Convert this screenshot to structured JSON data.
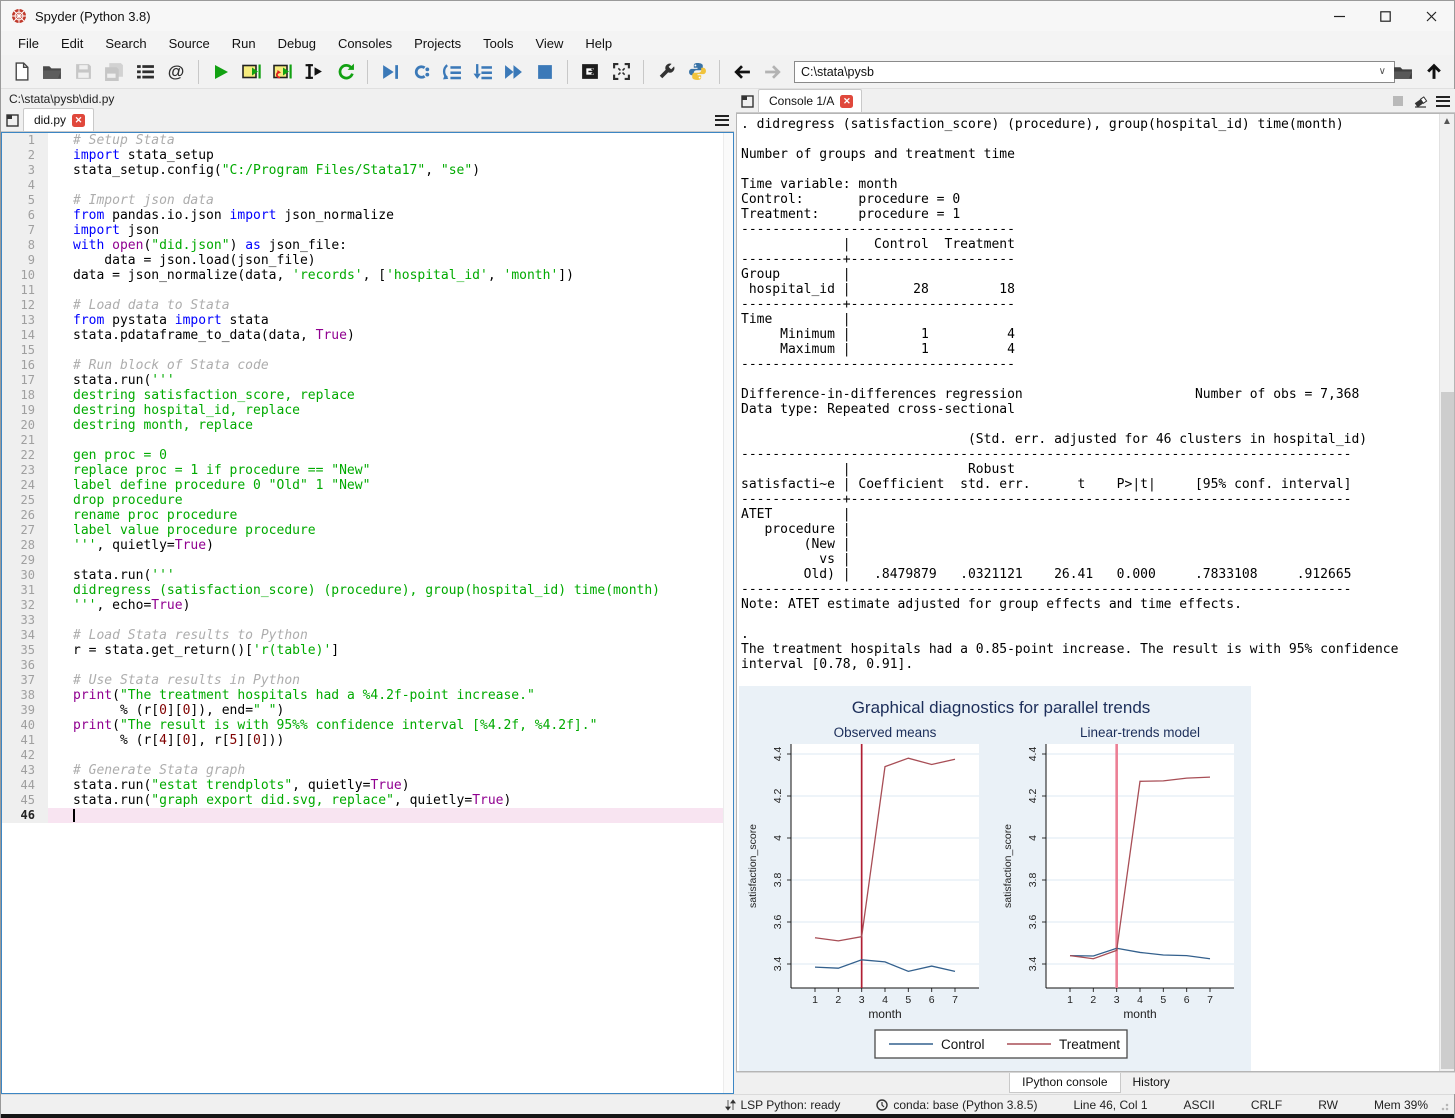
{
  "window": {
    "title": "Spyder (Python 3.8)"
  },
  "menu": [
    "File",
    "Edit",
    "Search",
    "Source",
    "Run",
    "Debug",
    "Consoles",
    "Projects",
    "Tools",
    "View",
    "Help"
  ],
  "toolbar": {
    "groups": [
      [
        "new-file",
        "open-file",
        "save-file",
        "save-all",
        "file-switcher",
        "symbol-finder"
      ],
      [
        "run-file",
        "run-cell",
        "run-cell-advance",
        "run-selection",
        "rerun-cell"
      ],
      [
        "debug-file",
        "debug-continue",
        "debug-step-over",
        "debug-step-into",
        "debug-step-return",
        "debug-stop"
      ],
      [
        "maximize-pane",
        "fullscreen"
      ],
      [
        "preferences",
        "python-interpreter"
      ],
      [
        "back",
        "forward"
      ]
    ],
    "address": {
      "value": "C:\\stata\\pysb"
    },
    "right_icons": [
      "open-directory",
      "parent-directory"
    ]
  },
  "editor": {
    "breadcrumb": "C:\\stata\\pysb\\did.py",
    "tab": "did.py",
    "current_line": 46,
    "lines": [
      [
        [
          "c",
          "# Setup Stata"
        ]
      ],
      [
        [
          "k",
          "import"
        ],
        [
          "t",
          " stata_setup"
        ]
      ],
      [
        [
          "t",
          "stata_setup.config("
        ],
        [
          "s",
          "\"C:/Program Files/Stata17\""
        ],
        [
          "t",
          ", "
        ],
        [
          "s",
          "\"se\""
        ],
        [
          "t",
          ")"
        ]
      ],
      [],
      [
        [
          "c",
          "# Import json data"
        ]
      ],
      [
        [
          "k",
          "from"
        ],
        [
          "t",
          " pandas.io.json "
        ],
        [
          "k",
          "import"
        ],
        [
          "t",
          " json_normalize"
        ]
      ],
      [
        [
          "k",
          "import"
        ],
        [
          "t",
          " json"
        ]
      ],
      [
        [
          "k",
          "with"
        ],
        [
          "t",
          " "
        ],
        [
          "b",
          "open"
        ],
        [
          "t",
          "("
        ],
        [
          "s",
          "\"did.json\""
        ],
        [
          "t",
          ") "
        ],
        [
          "k",
          "as"
        ],
        [
          "t",
          " json_file:"
        ]
      ],
      [
        [
          "t",
          "    data = json.load(json_file)"
        ]
      ],
      [
        [
          "t",
          "data = json_normalize(data, "
        ],
        [
          "s",
          "'records'"
        ],
        [
          "t",
          ", ["
        ],
        [
          "s",
          "'hospital_id'"
        ],
        [
          "t",
          ", "
        ],
        [
          "s",
          "'month'"
        ],
        [
          "t",
          "])"
        ]
      ],
      [],
      [
        [
          "c",
          "# Load data to Stata"
        ]
      ],
      [
        [
          "k",
          "from"
        ],
        [
          "t",
          " pystata "
        ],
        [
          "k",
          "import"
        ],
        [
          "t",
          " stata"
        ]
      ],
      [
        [
          "t",
          "stata.pdataframe_to_data(data, "
        ],
        [
          "b",
          "True"
        ],
        [
          "t",
          ")"
        ]
      ],
      [],
      [
        [
          "c",
          "# Run block of Stata code"
        ]
      ],
      [
        [
          "t",
          "stata.run("
        ],
        [
          "s",
          "'''"
        ]
      ],
      [
        [
          "s",
          "destring satisfaction_score, replace"
        ]
      ],
      [
        [
          "s",
          "destring hospital_id, replace"
        ]
      ],
      [
        [
          "s",
          "destring month, replace"
        ]
      ],
      [],
      [
        [
          "s",
          "gen proc = 0"
        ]
      ],
      [
        [
          "s",
          "replace proc = 1 if procedure == \"New\""
        ]
      ],
      [
        [
          "s",
          "label define procedure 0 \"Old\" 1 \"New\""
        ]
      ],
      [
        [
          "s",
          "drop procedure"
        ]
      ],
      [
        [
          "s",
          "rename proc procedure"
        ]
      ],
      [
        [
          "s",
          "label value procedure procedure"
        ]
      ],
      [
        [
          "s",
          "'''"
        ],
        [
          "t",
          ", quietly="
        ],
        [
          "b",
          "True"
        ],
        [
          "t",
          ")"
        ]
      ],
      [],
      [
        [
          "t",
          "stata.run("
        ],
        [
          "s",
          "'''"
        ]
      ],
      [
        [
          "s",
          "didregress (satisfaction_score) (procedure), group(hospital_id) time(month)"
        ]
      ],
      [
        [
          "s",
          "'''"
        ],
        [
          "t",
          ", echo="
        ],
        [
          "b",
          "True"
        ],
        [
          "t",
          ")"
        ]
      ],
      [],
      [
        [
          "c",
          "# Load Stata results to Python"
        ]
      ],
      [
        [
          "t",
          "r = stata.get_return()["
        ],
        [
          "s",
          "'r(table)'"
        ],
        [
          "t",
          "]"
        ]
      ],
      [],
      [
        [
          "c",
          "# Use Stata results in Python"
        ]
      ],
      [
        [
          "b",
          "print"
        ],
        [
          "t",
          "("
        ],
        [
          "s",
          "\"The treatment hospitals had a %4.2f-point increase.\""
        ]
      ],
      [
        [
          "t",
          "      % (r["
        ],
        [
          "n",
          "0"
        ],
        [
          "t",
          "]["
        ],
        [
          "n",
          "0"
        ],
        [
          "t",
          "]), end="
        ],
        [
          "s",
          "\" \""
        ],
        [
          "t",
          ")"
        ]
      ],
      [
        [
          "b",
          "print"
        ],
        [
          "t",
          "("
        ],
        [
          "s",
          "\"The result is with 95%% confidence interval [%4.2f, %4.2f].\""
        ]
      ],
      [
        [
          "t",
          "      % (r["
        ],
        [
          "n",
          "4"
        ],
        [
          "t",
          "]["
        ],
        [
          "n",
          "0"
        ],
        [
          "t",
          "], r["
        ],
        [
          "n",
          "5"
        ],
        [
          "t",
          "]["
        ],
        [
          "n",
          "0"
        ],
        [
          "t",
          "]))"
        ]
      ],
      [],
      [
        [
          "c",
          "# Generate Stata graph"
        ]
      ],
      [
        [
          "t",
          "stata.run("
        ],
        [
          "s",
          "\"estat trendplots\""
        ],
        [
          "t",
          ", quietly="
        ],
        [
          "b",
          "True"
        ],
        [
          "t",
          ")"
        ]
      ],
      [
        [
          "t",
          "stata.run("
        ],
        [
          "s",
          "\"graph export did.svg, replace\""
        ],
        [
          "t",
          ", quietly="
        ],
        [
          "b",
          "True"
        ],
        [
          "t",
          ")"
        ]
      ],
      []
    ]
  },
  "console": {
    "tab": "Console 1/A",
    "lines": [
      ". didregress (satisfaction_score) (procedure), group(hospital_id) time(month)",
      "",
      "Number of groups and treatment time",
      "",
      "Time variable: month",
      "Control:       procedure = 0",
      "Treatment:     procedure = 1",
      "-----------------------------------",
      "             |   Control  Treatment",
      "-------------+---------------------",
      "Group        |",
      " hospital_id |        28         18",
      "-------------+---------------------",
      "Time         |",
      "     Minimum |         1          4",
      "     Maximum |         1          4",
      "-----------------------------------",
      "",
      "Difference-in-differences regression                      Number of obs = 7,368",
      "Data type: Repeated cross-sectional",
      "",
      "                             (Std. err. adjusted for 46 clusters in hospital_id)",
      "------------------------------------------------------------------------------",
      "             |               Robust",
      "satisfacti~e | Coefficient  std. err.      t    P>|t|     [95% conf. interval]",
      "-------------+----------------------------------------------------------------",
      "ATET         |",
      "   procedure |",
      "        (New |",
      "          vs |",
      "        Old) |   .8479879   .0321121    26.41   0.000     .7833108     .912665",
      "------------------------------------------------------------------------------",
      "Note: ATET estimate adjusted for group effects and time effects.",
      "",
      ".",
      "The treatment hospitals had a 0.85-point increase. The result is with 95% confidence",
      "interval [0.78, 0.91]."
    ],
    "bottom_tabs": [
      "IPython console",
      "History"
    ]
  },
  "chart_data": {
    "type": "line",
    "title": "Graphical diagnostics for parallel trends",
    "xlabel": "month",
    "ylabel": "satisfaction_score",
    "x": [
      1,
      2,
      3,
      4,
      5,
      6,
      7
    ],
    "yticks": [
      3.4,
      3.6,
      3.8,
      4,
      4.2,
      4.4
    ],
    "ylim": [
      3.29,
      4.45
    ],
    "background": "#eaf1f7",
    "grid": true,
    "legend_position": "bottom",
    "panels": [
      {
        "title": "Observed means",
        "vline": {
          "x": 3,
          "color": "#b01e33"
        },
        "series": [
          {
            "name": "Control",
            "color": "#33608d",
            "values": [
              3.385,
              3.38,
              3.42,
              3.41,
              3.365,
              3.39,
              3.365
            ]
          },
          {
            "name": "Treatment",
            "color": "#a84e56",
            "values": [
              3.525,
              3.51,
              3.53,
              4.34,
              4.38,
              4.35,
              4.375
            ]
          }
        ]
      },
      {
        "title": "Linear-trends model",
        "vline": {
          "x": 3,
          "color": "#ec7f95"
        },
        "series": [
          {
            "name": "Control",
            "color": "#33608d",
            "values": [
              3.44,
              3.438,
              3.475,
              3.455,
              3.443,
              3.44,
              3.425
            ]
          },
          {
            "name": "Treatment",
            "color": "#a84e56",
            "values": [
              3.44,
              3.425,
              3.465,
              4.27,
              4.272,
              4.285,
              4.29
            ]
          }
        ]
      }
    ],
    "legend": [
      {
        "label": "Control",
        "color": "#33608d"
      },
      {
        "label": "Treatment",
        "color": "#a84e56"
      }
    ],
    "title_color": "#1c2e5a"
  },
  "statusbar": {
    "items": [
      "LSP Python: ready",
      "conda: base (Python 3.8.5)",
      "Line 46, Col 1",
      "ASCII",
      "CRLF",
      "RW",
      "Mem 39%"
    ]
  }
}
